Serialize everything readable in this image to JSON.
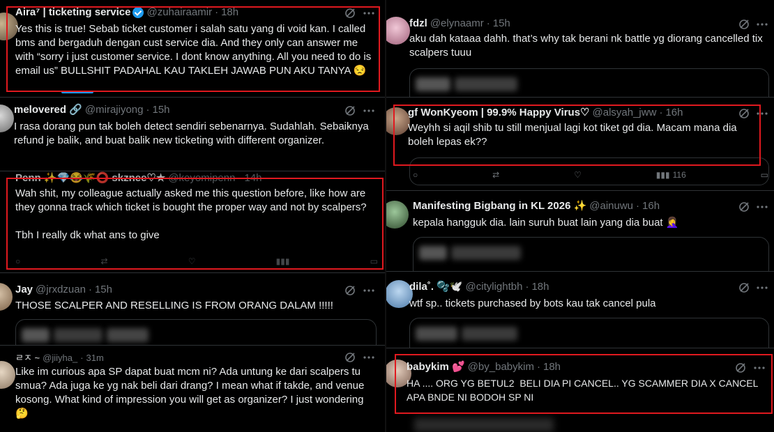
{
  "left": [
    {
      "name": "Aira⁷ | ticketing service",
      "handle": "@zuhairaamir",
      "time": "18h",
      "text": "Yes this is true! Sebab ticket customer i salah satu yang di void kan. I called bms and bergaduh dengan cust service dia. And they only can answer me with “sorry i just customer service. I dont know anything. All you need to do is email us” BULLSHIT PADAHAL KAU TAKLEH JAWAB PUN AKU TANYA 😒"
    },
    {
      "name": "melovered 🔗",
      "handle": "@mirajiyong",
      "time": "15h",
      "text": "I rasa dorang pun tak boleh detect sendiri sebenarnya. Sudahlah. Sebaiknya refund je balik, and buat balik new ticketing with different organizer."
    },
    {
      "name": "Penn ✨💎😂🌾⭕ skznee♡★",
      "handle": "@keyomipenn",
      "time": "14h",
      "text": "Wah shit, my colleague actually asked me this question before, like how are they gonna track which ticket is bought the proper way and not by scalpers?\n\nTbh I really dk what ans to give"
    },
    {
      "name": "Jay",
      "handle": "@jrxdzuan",
      "time": "15h",
      "text": "THOSE SCALPER AND RESELLING IS FROM ORANG DALAM !!!!!"
    },
    {
      "name": "ㄹㅈ ~",
      "handle": "@jiiyha_",
      "time": "31m",
      "text": "Like im curious apa SP dapat buat mcm ni? Ada untung ke dari scalpers tu smua? Ada juga ke yg nak beli dari drang? I mean what if takde, and venue kosong. What kind of impression you will get as organizer? I just wondering 🤔"
    }
  ],
  "right": [
    {
      "name": "fdzl",
      "handle": "@elynaamr",
      "time": "15h",
      "text": "aku dah kataaa dahh. that’s why tak berani nk battle yg diorang cancelled tix scalpers tuuu"
    },
    {
      "name": "gf WonKyeom | 99.9% Happy Virus♡",
      "handle": "@alsyah_jww",
      "time": "16h",
      "text": "Weyhh si aqil shib tu still menjual lagi kot tiket gd dia. Macam mana dia boleh lepas ek??",
      "views": "116"
    },
    {
      "name": "Manifesting Bigbang in KL 2026 ✨",
      "handle": "@ainuwu",
      "time": "16h",
      "text": "kepala hangguk dia. lain suruh buat lain yang dia buat 🤦‍♀️"
    },
    {
      "name": "dila˚.   🫧🕊️",
      "handle": "@citylightbh",
      "time": "18h",
      "text": "wtf sp.. tickets purchased by bots kau tak cancel pula"
    },
    {
      "name": "babykim 💕",
      "handle": "@by_babykim",
      "time": "18h",
      "text": "HA .... ORG YG BETUL2  BELI DIA PI CANCEL.. YG SCAMMER DIA X CANCEL APA BNDE NI BODOH SP NI"
    }
  ],
  "colors": {
    "background": "#000000",
    "text": "#e7e9ea",
    "muted": "#71767b",
    "verified": "#1d9bf0",
    "highlight": "#e0191f"
  }
}
